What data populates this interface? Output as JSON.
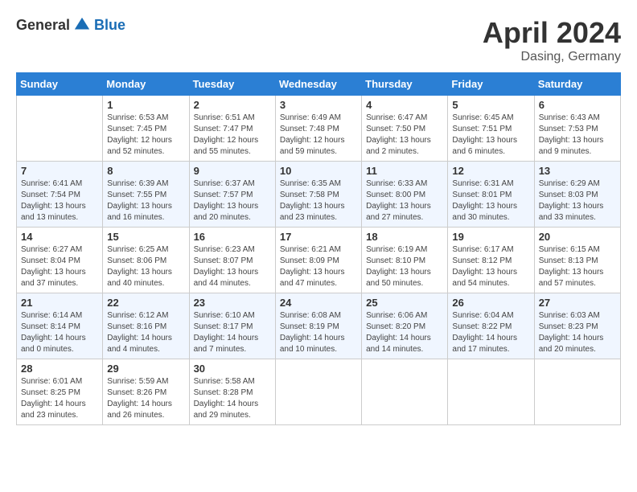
{
  "header": {
    "logo_general": "General",
    "logo_blue": "Blue",
    "month": "April 2024",
    "location": "Dasing, Germany"
  },
  "days_of_week": [
    "Sunday",
    "Monday",
    "Tuesday",
    "Wednesday",
    "Thursday",
    "Friday",
    "Saturday"
  ],
  "weeks": [
    [
      {
        "day": "",
        "sunrise": "",
        "sunset": "",
        "daylight": ""
      },
      {
        "day": "1",
        "sunrise": "6:53 AM",
        "sunset": "7:45 PM",
        "daylight": "12 hours and 52 minutes."
      },
      {
        "day": "2",
        "sunrise": "6:51 AM",
        "sunset": "7:47 PM",
        "daylight": "12 hours and 55 minutes."
      },
      {
        "day": "3",
        "sunrise": "6:49 AM",
        "sunset": "7:48 PM",
        "daylight": "12 hours and 59 minutes."
      },
      {
        "day": "4",
        "sunrise": "6:47 AM",
        "sunset": "7:50 PM",
        "daylight": "13 hours and 2 minutes."
      },
      {
        "day": "5",
        "sunrise": "6:45 AM",
        "sunset": "7:51 PM",
        "daylight": "13 hours and 6 minutes."
      },
      {
        "day": "6",
        "sunrise": "6:43 AM",
        "sunset": "7:53 PM",
        "daylight": "13 hours and 9 minutes."
      }
    ],
    [
      {
        "day": "7",
        "sunrise": "6:41 AM",
        "sunset": "7:54 PM",
        "daylight": "13 hours and 13 minutes."
      },
      {
        "day": "8",
        "sunrise": "6:39 AM",
        "sunset": "7:55 PM",
        "daylight": "13 hours and 16 minutes."
      },
      {
        "day": "9",
        "sunrise": "6:37 AM",
        "sunset": "7:57 PM",
        "daylight": "13 hours and 20 minutes."
      },
      {
        "day": "10",
        "sunrise": "6:35 AM",
        "sunset": "7:58 PM",
        "daylight": "13 hours and 23 minutes."
      },
      {
        "day": "11",
        "sunrise": "6:33 AM",
        "sunset": "8:00 PM",
        "daylight": "13 hours and 27 minutes."
      },
      {
        "day": "12",
        "sunrise": "6:31 AM",
        "sunset": "8:01 PM",
        "daylight": "13 hours and 30 minutes."
      },
      {
        "day": "13",
        "sunrise": "6:29 AM",
        "sunset": "8:03 PM",
        "daylight": "13 hours and 33 minutes."
      }
    ],
    [
      {
        "day": "14",
        "sunrise": "6:27 AM",
        "sunset": "8:04 PM",
        "daylight": "13 hours and 37 minutes."
      },
      {
        "day": "15",
        "sunrise": "6:25 AM",
        "sunset": "8:06 PM",
        "daylight": "13 hours and 40 minutes."
      },
      {
        "day": "16",
        "sunrise": "6:23 AM",
        "sunset": "8:07 PM",
        "daylight": "13 hours and 44 minutes."
      },
      {
        "day": "17",
        "sunrise": "6:21 AM",
        "sunset": "8:09 PM",
        "daylight": "13 hours and 47 minutes."
      },
      {
        "day": "18",
        "sunrise": "6:19 AM",
        "sunset": "8:10 PM",
        "daylight": "13 hours and 50 minutes."
      },
      {
        "day": "19",
        "sunrise": "6:17 AM",
        "sunset": "8:12 PM",
        "daylight": "13 hours and 54 minutes."
      },
      {
        "day": "20",
        "sunrise": "6:15 AM",
        "sunset": "8:13 PM",
        "daylight": "13 hours and 57 minutes."
      }
    ],
    [
      {
        "day": "21",
        "sunrise": "6:14 AM",
        "sunset": "8:14 PM",
        "daylight": "14 hours and 0 minutes."
      },
      {
        "day": "22",
        "sunrise": "6:12 AM",
        "sunset": "8:16 PM",
        "daylight": "14 hours and 4 minutes."
      },
      {
        "day": "23",
        "sunrise": "6:10 AM",
        "sunset": "8:17 PM",
        "daylight": "14 hours and 7 minutes."
      },
      {
        "day": "24",
        "sunrise": "6:08 AM",
        "sunset": "8:19 PM",
        "daylight": "14 hours and 10 minutes."
      },
      {
        "day": "25",
        "sunrise": "6:06 AM",
        "sunset": "8:20 PM",
        "daylight": "14 hours and 14 minutes."
      },
      {
        "day": "26",
        "sunrise": "6:04 AM",
        "sunset": "8:22 PM",
        "daylight": "14 hours and 17 minutes."
      },
      {
        "day": "27",
        "sunrise": "6:03 AM",
        "sunset": "8:23 PM",
        "daylight": "14 hours and 20 minutes."
      }
    ],
    [
      {
        "day": "28",
        "sunrise": "6:01 AM",
        "sunset": "8:25 PM",
        "daylight": "14 hours and 23 minutes."
      },
      {
        "day": "29",
        "sunrise": "5:59 AM",
        "sunset": "8:26 PM",
        "daylight": "14 hours and 26 minutes."
      },
      {
        "day": "30",
        "sunrise": "5:58 AM",
        "sunset": "8:28 PM",
        "daylight": "14 hours and 29 minutes."
      },
      {
        "day": "",
        "sunrise": "",
        "sunset": "",
        "daylight": ""
      },
      {
        "day": "",
        "sunrise": "",
        "sunset": "",
        "daylight": ""
      },
      {
        "day": "",
        "sunrise": "",
        "sunset": "",
        "daylight": ""
      },
      {
        "day": "",
        "sunrise": "",
        "sunset": "",
        "daylight": ""
      }
    ]
  ],
  "labels": {
    "sunrise_prefix": "Sunrise: ",
    "sunset_prefix": "Sunset: ",
    "daylight_prefix": "Daylight: "
  }
}
